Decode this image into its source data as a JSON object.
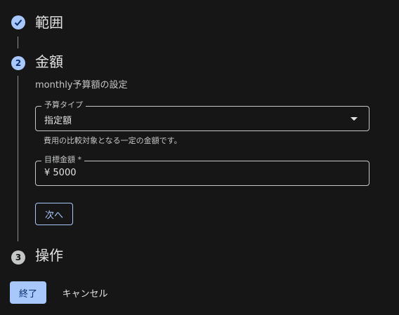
{
  "steps": [
    {
      "number": "",
      "title": "範囲",
      "state": "completed"
    },
    {
      "number": "2",
      "title": "金額",
      "state": "active"
    },
    {
      "number": "3",
      "title": "操作",
      "state": "inactive"
    }
  ],
  "amount_step": {
    "subtitle": "monthly予算額の設定",
    "budget_type": {
      "label": "予算タイプ",
      "value": "指定額",
      "hint": "費用の比較対象となる一定の金額です。"
    },
    "target_amount": {
      "label": "目標金額 *",
      "value": "¥ 5000"
    },
    "next_label": "次へ"
  },
  "actions": {
    "finish_label": "終了",
    "cancel_label": "キャンセル"
  },
  "colors": {
    "accent": "#a8c7fa",
    "background": "#161616"
  },
  "icons": {
    "completed": "check-icon",
    "dropdown": "dropdown-arrow-icon"
  }
}
